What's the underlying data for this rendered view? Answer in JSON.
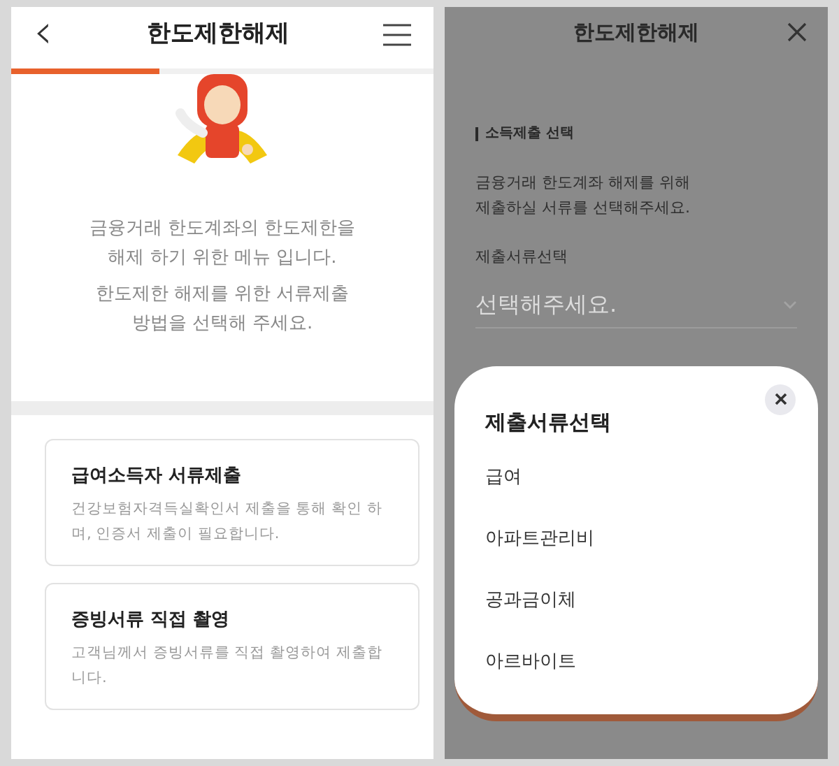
{
  "left_screen": {
    "header": {
      "back_icon": "‹",
      "title": "한도제한해제"
    },
    "progress": {
      "level": 0.35
    },
    "intro": [
      "금융거래 한도계좌의 한도제한을",
      "해제 하기 위한 메뉴 입니다.",
      "한도제한 해제를 위한 서류제출",
      "방법을 선택해 주세요."
    ],
    "options": [
      {
        "title": "급여소득자 서류제출",
        "description": "건강보험자격득실확인서 제출을 통해 확인 하며, 인증서 제출이 필요합니다."
      },
      {
        "title": "증빙서류 직접 촬영",
        "description": "고객님께서 증빙서류를 직접 촬영하여 제출합니다."
      }
    ]
  },
  "right_screen": {
    "header": {
      "title": "한도제한해제"
    },
    "section_label": "소득제출 선택",
    "instruction": [
      "금융거래 한도계좌 해제를 위해",
      "제출하실 서류를 선택해주세요."
    ],
    "select": {
      "label": "제출서류선택",
      "placeholder": "선택해주세요."
    },
    "sheet": {
      "title": "제출서류선택",
      "items": [
        "급여",
        "아파트관리비",
        "공과금이체",
        "아르바이트"
      ]
    }
  }
}
